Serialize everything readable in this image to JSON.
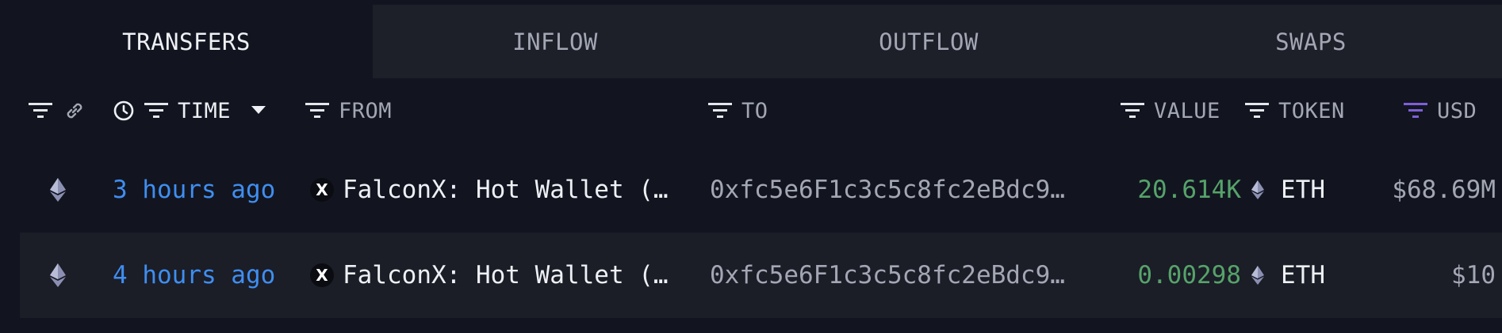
{
  "tabs": [
    {
      "label": "TRANSFERS",
      "active": true
    },
    {
      "label": "INFLOW",
      "active": false
    },
    {
      "label": "OUTFLOW",
      "active": false
    },
    {
      "label": "SWAPS",
      "active": false
    }
  ],
  "header": {
    "time_label": "TIME",
    "from_label": "FROM",
    "to_label": "TO",
    "value_label": "VALUE",
    "token_label": "TOKEN",
    "usd_label": "USD",
    "icons": [
      "filter-icon",
      "link-icon",
      "clock-icon",
      "filter-icon",
      "caret-down-icon",
      "filter-icon",
      "filter-icon",
      "filter-icon",
      "filter-icon",
      "filter-icon"
    ],
    "active_filter_color": "#7e5fd8"
  },
  "rows": [
    {
      "chain_icon": "eth-icon",
      "time": "3 hours ago",
      "from_logo": "X",
      "from": "FalconX: Hot Wallet (…",
      "to": "0xfc5e6F1c3c5c8fc2eBdc9…",
      "value": "20.614K",
      "token_icon": "eth-icon",
      "token": "ETH",
      "usd": "$68.69M"
    },
    {
      "chain_icon": "eth-icon",
      "time": "4 hours ago",
      "from_logo": "X",
      "from": "FalconX: Hot Wallet (…",
      "to": "0xfc5e6F1c3c5c8fc2eBdc9…",
      "value": "0.00298",
      "token_icon": "eth-icon",
      "token": "ETH",
      "usd": "$10"
    }
  ],
  "colors": {
    "background": "#121520",
    "time_link": "#3f8ef0",
    "value_positive": "#56a36a"
  }
}
